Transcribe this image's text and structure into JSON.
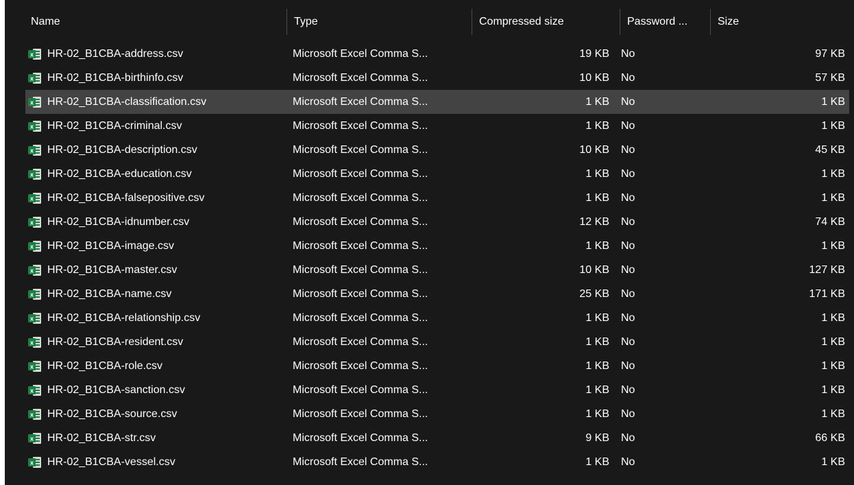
{
  "columns": {
    "name": "Name",
    "type": "Type",
    "compressed_size": "Compressed size",
    "password": "Password ...",
    "size": "Size"
  },
  "icons": {
    "sort": "chevron-up-icon",
    "file": "excel-csv-file-icon"
  },
  "colors": {
    "background": "#191919",
    "selected_row": "#434343",
    "icon_green": "#1e7e45"
  },
  "files": [
    {
      "name": "HR-02_B1CBA-address.csv",
      "type": "Microsoft Excel Comma S...",
      "compressed_size": "19 KB",
      "password": "No",
      "size": "97 KB"
    },
    {
      "name": "HR-02_B1CBA-birthinfo.csv",
      "type": "Microsoft Excel Comma S...",
      "compressed_size": "10 KB",
      "password": "No",
      "size": "57 KB"
    },
    {
      "name": "HR-02_B1CBA-classification.csv",
      "type": "Microsoft Excel Comma S...",
      "compressed_size": "1 KB",
      "password": "No",
      "size": "1 KB",
      "selected": true
    },
    {
      "name": "HR-02_B1CBA-criminal.csv",
      "type": "Microsoft Excel Comma S...",
      "compressed_size": "1 KB",
      "password": "No",
      "size": "1 KB"
    },
    {
      "name": "HR-02_B1CBA-description.csv",
      "type": "Microsoft Excel Comma S...",
      "compressed_size": "10 KB",
      "password": "No",
      "size": "45 KB"
    },
    {
      "name": "HR-02_B1CBA-education.csv",
      "type": "Microsoft Excel Comma S...",
      "compressed_size": "1 KB",
      "password": "No",
      "size": "1 KB"
    },
    {
      "name": "HR-02_B1CBA-falsepositive.csv",
      "type": "Microsoft Excel Comma S...",
      "compressed_size": "1 KB",
      "password": "No",
      "size": "1 KB"
    },
    {
      "name": "HR-02_B1CBA-idnumber.csv",
      "type": "Microsoft Excel Comma S...",
      "compressed_size": "12 KB",
      "password": "No",
      "size": "74 KB"
    },
    {
      "name": "HR-02_B1CBA-image.csv",
      "type": "Microsoft Excel Comma S...",
      "compressed_size": "1 KB",
      "password": "No",
      "size": "1 KB"
    },
    {
      "name": "HR-02_B1CBA-master.csv",
      "type": "Microsoft Excel Comma S...",
      "compressed_size": "10 KB",
      "password": "No",
      "size": "127 KB"
    },
    {
      "name": "HR-02_B1CBA-name.csv",
      "type": "Microsoft Excel Comma S...",
      "compressed_size": "25 KB",
      "password": "No",
      "size": "171 KB"
    },
    {
      "name": "HR-02_B1CBA-relationship.csv",
      "type": "Microsoft Excel Comma S...",
      "compressed_size": "1 KB",
      "password": "No",
      "size": "1 KB"
    },
    {
      "name": "HR-02_B1CBA-resident.csv",
      "type": "Microsoft Excel Comma S...",
      "compressed_size": "1 KB",
      "password": "No",
      "size": "1 KB"
    },
    {
      "name": "HR-02_B1CBA-role.csv",
      "type": "Microsoft Excel Comma S...",
      "compressed_size": "1 KB",
      "password": "No",
      "size": "1 KB"
    },
    {
      "name": "HR-02_B1CBA-sanction.csv",
      "type": "Microsoft Excel Comma S...",
      "compressed_size": "1 KB",
      "password": "No",
      "size": "1 KB"
    },
    {
      "name": "HR-02_B1CBA-source.csv",
      "type": "Microsoft Excel Comma S...",
      "compressed_size": "1 KB",
      "password": "No",
      "size": "1 KB"
    },
    {
      "name": "HR-02_B1CBA-str.csv",
      "type": "Microsoft Excel Comma S...",
      "compressed_size": "9 KB",
      "password": "No",
      "size": "66 KB"
    },
    {
      "name": "HR-02_B1CBA-vessel.csv",
      "type": "Microsoft Excel Comma S...",
      "compressed_size": "1 KB",
      "password": "No",
      "size": "1 KB"
    }
  ]
}
